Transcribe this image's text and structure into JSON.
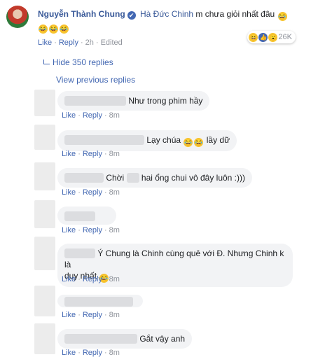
{
  "main_comment": {
    "author": "Nguyễn Thành Chung",
    "verified_symbol": "✔",
    "mention": "Hà Đức Chinh",
    "text": "m chưa giỏi nhất đâu",
    "actions": {
      "like": "Like",
      "reply": "Reply",
      "time": "2h",
      "edited": "Edited"
    },
    "reaction_count": "26K"
  },
  "thread": {
    "hide_replies": "Hide 350 replies",
    "view_previous": "View previous replies"
  },
  "replies": [
    {
      "text": "Như trong phim hầy",
      "like": "Like",
      "reply": "Reply",
      "time": "8m"
    },
    {
      "text": "Lạy chúa",
      "suffix": "lầy dữ",
      "like": "Like",
      "reply": "Reply",
      "time": "8m"
    },
    {
      "prefix": "Chời",
      "text": "hai ổng chui vô đây luôn :)))",
      "like": "Like",
      "reply": "Reply",
      "time": "8m"
    },
    {
      "text": "",
      "like": "Like",
      "reply": "Reply",
      "time": "8m"
    },
    {
      "text": "Ý Chung là Chinh cùng quê với Đ. Nhưng Chinh k là",
      "text2": "duy nhất",
      "like": "Like",
      "reply": "Reply",
      "time": "8m"
    },
    {
      "text": "",
      "like": "Like",
      "reply": "Reply",
      "time": "8m"
    },
    {
      "text": "Gắt vậy anh",
      "like": "Like",
      "reply": "Reply",
      "time": "8m"
    }
  ],
  "colors": {
    "link": "#4267b2",
    "name": "#385898",
    "bubble": "#f2f3f5",
    "muted": "#90949c"
  }
}
